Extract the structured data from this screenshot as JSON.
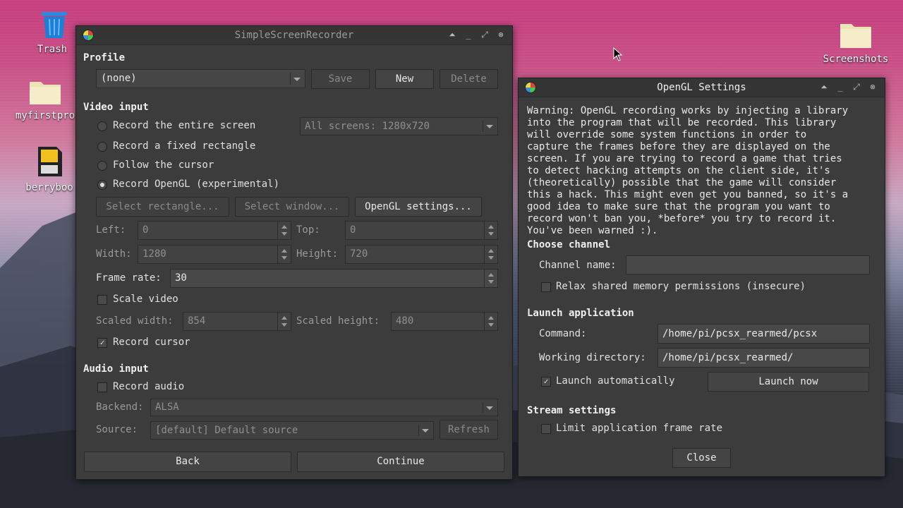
{
  "desktop": {
    "icons": [
      {
        "label": "Trash"
      },
      {
        "label": "myfirstpro"
      },
      {
        "label": "berryboo"
      },
      {
        "label": "Screenshots"
      }
    ]
  },
  "ssr": {
    "title": "SimpleScreenRecorder",
    "profile": {
      "heading": "Profile",
      "selected": "(none)",
      "save_label": "Save",
      "new_label": "New",
      "delete_label": "Delete"
    },
    "video": {
      "heading": "Video input",
      "radio_entire": "Record the entire screen",
      "radio_fixed": "Record a fixed rectangle",
      "radio_cursor": "Follow the cursor",
      "radio_opengl": "Record OpenGL (experimental)",
      "screens_value": "All screens: 1280x720",
      "select_rect_label": "Select rectangle...",
      "select_window_label": "Select window...",
      "opengl_settings_label": "OpenGL settings...",
      "left_label": "Left:",
      "left_value": "0",
      "top_label": "Top:",
      "top_value": "0",
      "width_label": "Width:",
      "width_value": "1280",
      "height_label": "Height:",
      "height_value": "720",
      "framerate_label": "Frame rate:",
      "framerate_value": "30",
      "scale_label": "Scale video",
      "scaled_width_label": "Scaled width:",
      "scaled_width_value": "854",
      "scaled_height_label": "Scaled height:",
      "scaled_height_value": "480",
      "record_cursor_label": "Record cursor"
    },
    "audio": {
      "heading": "Audio input",
      "record_audio_label": "Record audio",
      "backend_label": "Backend:",
      "backend_value": "ALSA",
      "source_label": "Source:",
      "source_value": "[default] Default source",
      "refresh_label": "Refresh"
    },
    "back_label": "Back",
    "continue_label": "Continue"
  },
  "opengl": {
    "title": "OpenGL Settings",
    "warning": "Warning: OpenGL recording works by injecting a library\ninto the program that will be recorded. This library\nwill override some system functions in order to\ncapture the frames before they are displayed on the\nscreen. If you are trying to record a game that tries\nto detect hacking attempts on the client side, it's\n(theoretically) possible that the game will consider\nthis a hack. This might even get you banned, so it's a\ngood idea to make sure that the program you want to\nrecord won't ban you, *before* you try to record it.\nYou've been warned :).",
    "channel_heading": "Choose channel",
    "channel_name_label": "Channel name:",
    "channel_name_value": "",
    "relax_label": "Relax shared memory permissions (insecure)",
    "launch_heading": "Launch application",
    "command_label": "Command:",
    "command_value": "/home/pi/pcsx_rearmed/pcsx",
    "workdir_label": "Working directory:",
    "workdir_value": "/home/pi/pcsx_rearmed/",
    "launch_auto_label": "Launch automatically",
    "launch_now_label": "Launch now",
    "stream_heading": "Stream settings",
    "limit_label": "Limit application frame rate",
    "close_label": "Close"
  }
}
